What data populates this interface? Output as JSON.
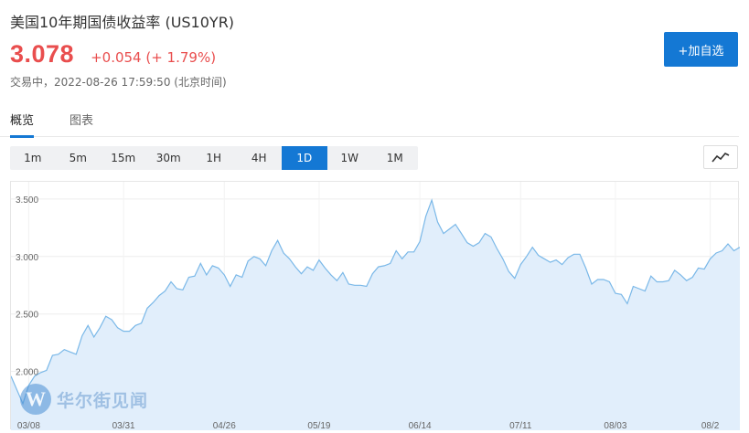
{
  "header": {
    "title": "美国10年期国债收益率  (US10YR)",
    "price": "3.078",
    "change": "+0.054 (+ 1.79%)",
    "status": "交易中，2022-08-26 17:59:50 (北京时间)",
    "add_button": "+加自选"
  },
  "tabs": [
    {
      "label": "概览",
      "active": true
    },
    {
      "label": "图表",
      "active": false
    }
  ],
  "periods": [
    {
      "label": "1m",
      "active": false
    },
    {
      "label": "5m",
      "active": false
    },
    {
      "label": "15m",
      "active": false
    },
    {
      "label": "30m",
      "active": false
    },
    {
      "label": "1H",
      "active": false
    },
    {
      "label": "4H",
      "active": false
    },
    {
      "label": "1D",
      "active": true
    },
    {
      "label": "1W",
      "active": false
    },
    {
      "label": "1M",
      "active": false
    }
  ],
  "chart_type_icon": "line-chart-icon",
  "watermark": {
    "text": "华尔街见闻",
    "logo_letter": "W"
  },
  "colors": {
    "accent": "#1478d4",
    "up": "#e94e4e",
    "line": "#7ab8e8",
    "fill": "#e1eefb"
  },
  "chart_data": {
    "type": "area",
    "y_ticks": [
      "3.500",
      "3.000",
      "2.500",
      "2.000"
    ],
    "y_tick_values": [
      3.5,
      3.0,
      2.5,
      2.0
    ],
    "ylim": [
      1.6,
      3.65
    ],
    "x_tick_labels": [
      "03/08",
      "03/31",
      "04/26",
      "05/19",
      "06/14",
      "07/11",
      "08/03",
      "08/2"
    ],
    "x_tick_index": [
      3,
      19,
      36,
      52,
      69,
      86,
      102,
      118
    ],
    "grid": true,
    "values": [
      1.96,
      1.84,
      1.72,
      1.88,
      1.96,
      1.99,
      2.01,
      2.14,
      2.15,
      2.19,
      2.17,
      2.15,
      2.31,
      2.4,
      2.3,
      2.38,
      2.48,
      2.45,
      2.38,
      2.35,
      2.35,
      2.4,
      2.42,
      2.55,
      2.6,
      2.66,
      2.7,
      2.78,
      2.72,
      2.71,
      2.82,
      2.83,
      2.94,
      2.84,
      2.92,
      2.9,
      2.84,
      2.74,
      2.84,
      2.82,
      2.96,
      3.0,
      2.98,
      2.92,
      3.05,
      3.14,
      3.03,
      2.98,
      2.91,
      2.85,
      2.91,
      2.88,
      2.97,
      2.9,
      2.84,
      2.79,
      2.86,
      2.76,
      2.75,
      2.75,
      2.74,
      2.85,
      2.91,
      2.92,
      2.94,
      3.05,
      2.98,
      3.04,
      3.04,
      3.13,
      3.35,
      3.49,
      3.3,
      3.2,
      3.24,
      3.28,
      3.2,
      3.12,
      3.09,
      3.12,
      3.2,
      3.17,
      3.07,
      2.98,
      2.87,
      2.81,
      2.93,
      3.0,
      3.08,
      3.01,
      2.98,
      2.95,
      2.97,
      2.93,
      2.99,
      3.02,
      3.02,
      2.9,
      2.76,
      2.8,
      2.8,
      2.78,
      2.68,
      2.67,
      2.59,
      2.74,
      2.72,
      2.7,
      2.83,
      2.78,
      2.78,
      2.79,
      2.88,
      2.84,
      2.79,
      2.82,
      2.9,
      2.89,
      2.98,
      3.03,
      3.05,
      3.11,
      3.05,
      3.08
    ]
  }
}
